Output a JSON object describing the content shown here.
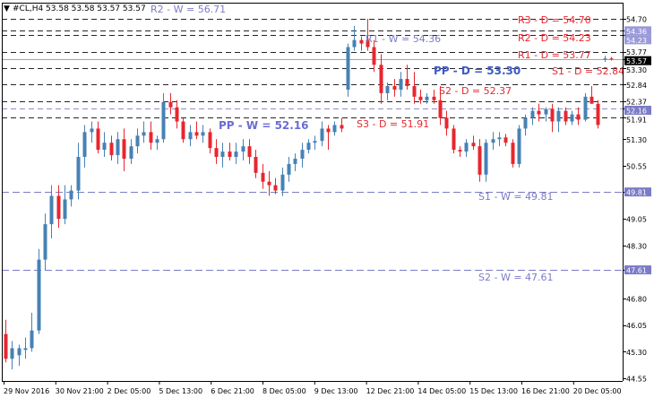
{
  "chart_data": {
    "type": "candlestick",
    "header": "#CL,H4  53.58 53.58 53.57 53.57",
    "colors": {
      "bull": "#4682b4",
      "bear": "#e8262e",
      "daily_level": "#e8262e",
      "weekly_level": "#7b7bc8",
      "pivot_daily": "#3c5ac8",
      "pivot_weekly": "#6b6bd6",
      "axis_label_fill": "#7b7bc8",
      "line": "#000000"
    },
    "ylim": [
      44.55,
      54.85
    ],
    "y_ticks": [
      "54.70",
      "54.36",
      "54.23",
      "53.77",
      "53.57",
      "53.30",
      "52.84",
      "52.37",
      "52.16",
      "51.91",
      "51.30",
      "50.55",
      "49.81",
      "49.05",
      "48.30",
      "47.61",
      "46.80",
      "46.05",
      "45.30",
      "44.55"
    ],
    "x_ticks": [
      "29 Nov 2016",
      "30 Nov 21:00",
      "2 Dec 05:00",
      "5 Dec 13:00",
      "6 Dec 21:00",
      "8 Dec 05:00",
      "9 Dec 13:00",
      "12 Dec 21:00",
      "14 Dec 05:00",
      "15 Dec 13:00",
      "16 Dec 21:00",
      "20 Dec 05:00"
    ],
    "levels": [
      {
        "label": "R3 - D = 54.70",
        "value": 54.7,
        "kind": "daily"
      },
      {
        "label": "R2 - D = 54.23",
        "value": 54.23,
        "kind": "daily"
      },
      {
        "label": "R1 - D = 53.77",
        "value": 53.77,
        "kind": "daily"
      },
      {
        "label": "PP - D = 53.30",
        "value": 53.3,
        "kind": "pivot-daily"
      },
      {
        "label": "S1 - D = 52.84",
        "value": 52.84,
        "kind": "daily"
      },
      {
        "label": "S2 - D = 52.37",
        "value": 52.37,
        "kind": "daily"
      },
      {
        "label": "S3 - D = 51.91",
        "value": 51.91,
        "kind": "daily"
      },
      {
        "label": "R2 - W = 56.71",
        "value": 56.71,
        "kind": "weekly"
      },
      {
        "label": "R1 - W = 54.36",
        "value": 54.36,
        "kind": "weekly"
      },
      {
        "label": "PP - W = 52.16",
        "value": 52.16,
        "kind": "pivot-weekly"
      },
      {
        "label": "S1 - W = 49.81",
        "value": 49.81,
        "kind": "weekly"
      },
      {
        "label": "S2 - W = 47.61",
        "value": 47.61,
        "kind": "weekly"
      }
    ],
    "candles": [
      {
        "o": 45.8,
        "h": 46.2,
        "l": 45.0,
        "c": 45.1
      },
      {
        "o": 45.1,
        "h": 45.6,
        "l": 44.8,
        "c": 45.4
      },
      {
        "o": 45.2,
        "h": 45.5,
        "l": 44.9,
        "c": 45.4
      },
      {
        "o": 45.35,
        "h": 45.7,
        "l": 45.1,
        "c": 45.4
      },
      {
        "o": 45.4,
        "h": 46.4,
        "l": 45.3,
        "c": 45.9
      },
      {
        "o": 45.9,
        "h": 48.2,
        "l": 45.8,
        "c": 47.9
      },
      {
        "o": 47.9,
        "h": 49.2,
        "l": 47.6,
        "c": 48.9
      },
      {
        "o": 48.9,
        "h": 50.0,
        "l": 48.5,
        "c": 49.7
      },
      {
        "o": 49.7,
        "h": 50.0,
        "l": 48.8,
        "c": 49.05
      },
      {
        "o": 49.05,
        "h": 50.0,
        "l": 48.9,
        "c": 49.6
      },
      {
        "o": 49.6,
        "h": 50.0,
        "l": 49.4,
        "c": 49.85
      },
      {
        "o": 49.85,
        "h": 51.2,
        "l": 49.6,
        "c": 50.8
      },
      {
        "o": 50.8,
        "h": 51.7,
        "l": 50.5,
        "c": 51.5
      },
      {
        "o": 51.5,
        "h": 51.8,
        "l": 51.2,
        "c": 51.6
      },
      {
        "o": 51.6,
        "h": 51.8,
        "l": 50.9,
        "c": 51.0
      },
      {
        "o": 51.0,
        "h": 51.5,
        "l": 50.8,
        "c": 51.2
      },
      {
        "o": 51.2,
        "h": 51.4,
        "l": 50.7,
        "c": 50.85
      },
      {
        "o": 50.85,
        "h": 51.5,
        "l": 50.6,
        "c": 51.3
      },
      {
        "o": 51.3,
        "h": 51.6,
        "l": 50.4,
        "c": 50.75
      },
      {
        "o": 50.75,
        "h": 51.3,
        "l": 50.6,
        "c": 51.1
      },
      {
        "o": 51.1,
        "h": 51.6,
        "l": 50.9,
        "c": 51.4
      },
      {
        "o": 51.4,
        "h": 51.8,
        "l": 51.2,
        "c": 51.5
      },
      {
        "o": 51.5,
        "h": 51.8,
        "l": 51.0,
        "c": 51.2
      },
      {
        "o": 51.2,
        "h": 51.4,
        "l": 51.0,
        "c": 51.3
      },
      {
        "o": 51.3,
        "h": 52.6,
        "l": 51.2,
        "c": 52.35
      },
      {
        "o": 52.35,
        "h": 52.6,
        "l": 52.0,
        "c": 52.2
      },
      {
        "o": 52.2,
        "h": 52.4,
        "l": 51.6,
        "c": 51.8
      },
      {
        "o": 51.8,
        "h": 51.9,
        "l": 51.2,
        "c": 51.3
      },
      {
        "o": 51.3,
        "h": 51.7,
        "l": 51.1,
        "c": 51.5
      },
      {
        "o": 51.5,
        "h": 51.8,
        "l": 51.3,
        "c": 51.4
      },
      {
        "o": 51.4,
        "h": 51.7,
        "l": 51.2,
        "c": 51.5
      },
      {
        "o": 51.5,
        "h": 51.6,
        "l": 50.9,
        "c": 51.05
      },
      {
        "o": 51.05,
        "h": 51.3,
        "l": 50.6,
        "c": 50.8
      },
      {
        "o": 50.8,
        "h": 51.2,
        "l": 50.5,
        "c": 50.95
      },
      {
        "o": 50.95,
        "h": 51.2,
        "l": 50.7,
        "c": 50.8
      },
      {
        "o": 50.8,
        "h": 51.2,
        "l": 50.6,
        "c": 50.95
      },
      {
        "o": 50.95,
        "h": 51.3,
        "l": 50.7,
        "c": 51.1
      },
      {
        "o": 51.1,
        "h": 51.3,
        "l": 50.6,
        "c": 50.8
      },
      {
        "o": 50.8,
        "h": 51.0,
        "l": 50.2,
        "c": 50.35
      },
      {
        "o": 50.35,
        "h": 50.6,
        "l": 49.9,
        "c": 50.1
      },
      {
        "o": 50.1,
        "h": 50.4,
        "l": 49.7,
        "c": 50.0
      },
      {
        "o": 50.0,
        "h": 50.2,
        "l": 49.75,
        "c": 49.85
      },
      {
        "o": 49.85,
        "h": 50.5,
        "l": 49.7,
        "c": 50.3
      },
      {
        "o": 50.3,
        "h": 50.8,
        "l": 50.1,
        "c": 50.6
      },
      {
        "o": 50.6,
        "h": 50.9,
        "l": 50.4,
        "c": 50.75
      },
      {
        "o": 50.75,
        "h": 51.2,
        "l": 50.5,
        "c": 51.0
      },
      {
        "o": 51.0,
        "h": 51.3,
        "l": 50.9,
        "c": 51.2
      },
      {
        "o": 51.2,
        "h": 51.4,
        "l": 51.0,
        "c": 51.25
      },
      {
        "o": 51.25,
        "h": 51.8,
        "l": 51.1,
        "c": 51.6
      },
      {
        "o": 51.6,
        "h": 51.7,
        "l": 51.0,
        "c": 51.5
      },
      {
        "o": 51.5,
        "h": 51.8,
        "l": 51.4,
        "c": 51.7
      },
      {
        "o": 51.7,
        "h": 51.9,
        "l": 51.5,
        "c": 51.6
      },
      {
        "o": 52.7,
        "h": 54.0,
        "l": 52.5,
        "c": 53.9
      },
      {
        "o": 53.9,
        "h": 54.5,
        "l": 53.8,
        "c": 54.1
      },
      {
        "o": 54.1,
        "h": 54.2,
        "l": 53.8,
        "c": 54.0
      },
      {
        "o": 54.1,
        "h": 54.7,
        "l": 53.8,
        "c": 53.9
      },
      {
        "o": 53.9,
        "h": 54.1,
        "l": 53.2,
        "c": 53.4
      },
      {
        "o": 53.4,
        "h": 53.7,
        "l": 52.3,
        "c": 52.6
      },
      {
        "o": 52.6,
        "h": 52.9,
        "l": 52.4,
        "c": 52.8
      },
      {
        "o": 52.8,
        "h": 53.0,
        "l": 52.5,
        "c": 52.7
      },
      {
        "o": 52.7,
        "h": 53.2,
        "l": 52.5,
        "c": 53.0
      },
      {
        "o": 53.0,
        "h": 53.4,
        "l": 52.7,
        "c": 52.8
      },
      {
        "o": 52.8,
        "h": 53.2,
        "l": 52.3,
        "c": 52.5
      },
      {
        "o": 52.5,
        "h": 52.7,
        "l": 52.3,
        "c": 52.4
      },
      {
        "o": 52.4,
        "h": 52.6,
        "l": 52.3,
        "c": 52.5
      },
      {
        "o": 52.5,
        "h": 52.7,
        "l": 52.3,
        "c": 52.4
      },
      {
        "o": 52.4,
        "h": 52.8,
        "l": 51.7,
        "c": 51.9
      },
      {
        "o": 51.9,
        "h": 52.1,
        "l": 51.4,
        "c": 51.6
      },
      {
        "o": 51.6,
        "h": 51.7,
        "l": 50.9,
        "c": 51.0
      },
      {
        "o": 51.0,
        "h": 51.1,
        "l": 50.8,
        "c": 50.95
      },
      {
        "o": 50.95,
        "h": 51.3,
        "l": 50.8,
        "c": 51.2
      },
      {
        "o": 51.2,
        "h": 51.4,
        "l": 51.0,
        "c": 51.1
      },
      {
        "o": 51.1,
        "h": 51.3,
        "l": 50.1,
        "c": 50.3
      },
      {
        "o": 50.3,
        "h": 51.3,
        "l": 50.1,
        "c": 51.2
      },
      {
        "o": 51.2,
        "h": 51.5,
        "l": 51.0,
        "c": 51.3
      },
      {
        "o": 51.3,
        "h": 51.5,
        "l": 51.1,
        "c": 51.35
      },
      {
        "o": 51.35,
        "h": 51.45,
        "l": 51.1,
        "c": 51.2
      },
      {
        "o": 51.2,
        "h": 51.3,
        "l": 50.5,
        "c": 50.6
      },
      {
        "o": 50.6,
        "h": 51.7,
        "l": 50.5,
        "c": 51.6
      },
      {
        "o": 51.6,
        "h": 52.0,
        "l": 51.4,
        "c": 51.9
      },
      {
        "o": 51.9,
        "h": 52.2,
        "l": 51.7,
        "c": 52.1
      },
      {
        "o": 52.1,
        "h": 52.3,
        "l": 51.8,
        "c": 52.0
      },
      {
        "o": 52.0,
        "h": 52.2,
        "l": 51.8,
        "c": 52.15
      },
      {
        "o": 52.15,
        "h": 52.3,
        "l": 51.5,
        "c": 51.8
      },
      {
        "o": 51.8,
        "h": 52.2,
        "l": 51.5,
        "c": 52.1
      },
      {
        "o": 52.1,
        "h": 52.2,
        "l": 51.7,
        "c": 51.8
      },
      {
        "o": 51.8,
        "h": 52.1,
        "l": 51.7,
        "c": 52.0
      },
      {
        "o": 52.0,
        "h": 52.2,
        "l": 51.7,
        "c": 51.85
      },
      {
        "o": 51.85,
        "h": 52.6,
        "l": 51.8,
        "c": 52.5
      },
      {
        "o": 52.5,
        "h": 52.8,
        "l": 52.3,
        "c": 52.3
      },
      {
        "o": 52.3,
        "h": 52.4,
        "l": 51.6,
        "c": 51.7
      },
      {
        "o": 53.55,
        "h": 53.65,
        "l": 53.48,
        "c": 53.58
      },
      {
        "o": 53.58,
        "h": 53.62,
        "l": 53.52,
        "c": 53.57
      }
    ]
  }
}
